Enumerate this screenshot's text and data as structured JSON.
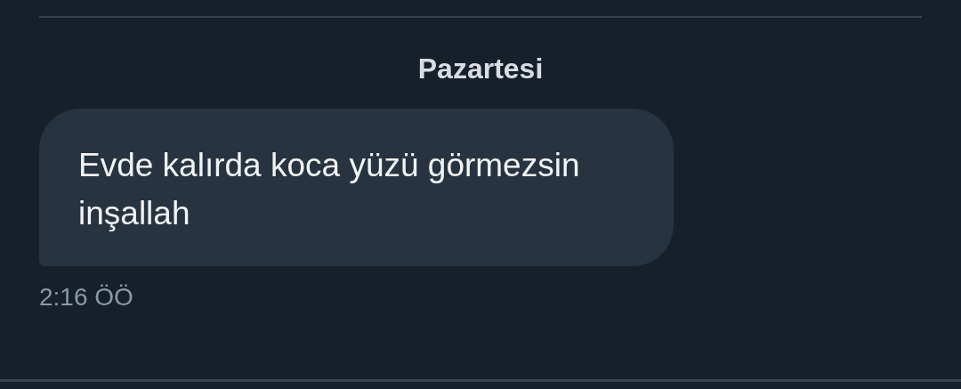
{
  "day_label": "Pazartesi",
  "messages": [
    {
      "text": "Evde kalırda koca yüzü görmezsin inşallah",
      "time": "2:16 ÖÖ"
    }
  ]
}
